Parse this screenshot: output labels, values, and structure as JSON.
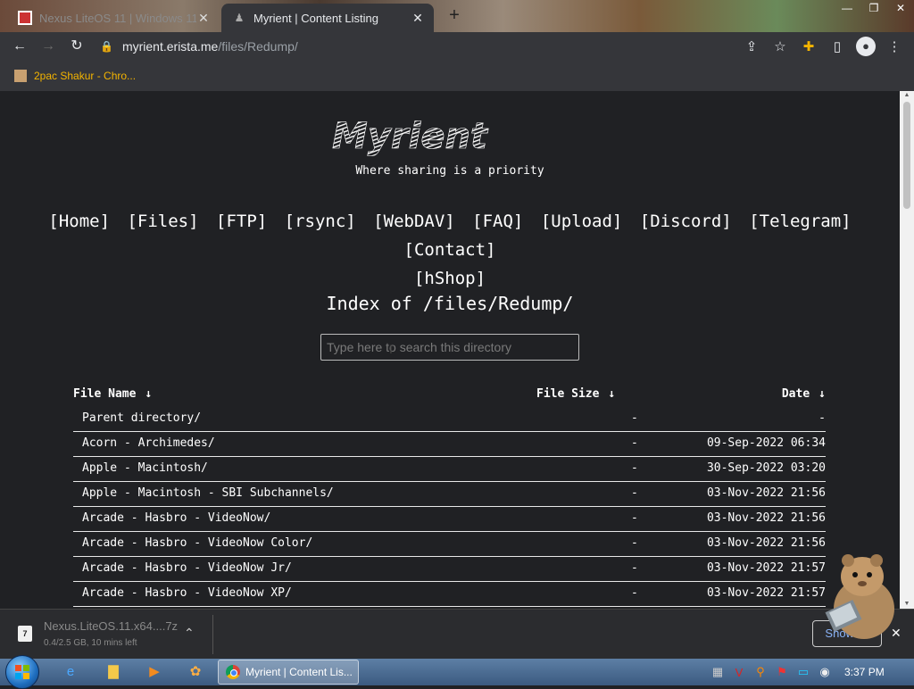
{
  "browser": {
    "tabs": [
      {
        "title": "Nexus LiteOS 11 | Windows 11 Li...",
        "active": false
      },
      {
        "title": "Myrient | Content Listing",
        "active": true
      }
    ],
    "url_host": "myrient.erista.me",
    "url_path": "/files/Redump/",
    "bookmark": "2pac Shakur - Chro..."
  },
  "page": {
    "logo_text": "Myrient",
    "tagline": "Where sharing is a priority",
    "nav": [
      "[Home]",
      "[Files]",
      "[FTP]",
      "[rsync]",
      "[WebDAV]",
      "[FAQ]",
      "[Upload]",
      "[Discord]",
      "[Telegram]",
      "[Contact]",
      "[hShop]"
    ],
    "title": "Index of /files/Redump/",
    "search_placeholder": "Type here to search this directory",
    "columns": {
      "name": "File Name",
      "size": "File Size",
      "date": "Date",
      "sort_icon": "↓"
    },
    "rows": [
      {
        "name": "Parent directory/",
        "size": "-",
        "date": "-"
      },
      {
        "name": "Acorn - Archimedes/",
        "size": "-",
        "date": "09-Sep-2022 06:34"
      },
      {
        "name": "Apple - Macintosh/",
        "size": "-",
        "date": "30-Sep-2022 03:20"
      },
      {
        "name": "Apple - Macintosh - SBI Subchannels/",
        "size": "-",
        "date": "03-Nov-2022 21:56"
      },
      {
        "name": "Arcade - Hasbro - VideoNow/",
        "size": "-",
        "date": "03-Nov-2022 21:56"
      },
      {
        "name": "Arcade - Hasbro - VideoNow Color/",
        "size": "-",
        "date": "03-Nov-2022 21:56"
      },
      {
        "name": "Arcade - Hasbro - VideoNow Jr/",
        "size": "-",
        "date": "03-Nov-2022 21:57"
      },
      {
        "name": "Arcade - Hasbro - VideoNow XP/",
        "size": "-",
        "date": "03-Nov-2022 21:57"
      }
    ]
  },
  "download": {
    "file_name": "Nexus.LiteOS.11.x64....7z",
    "status": "0.4/2.5 GB, 10 mins left",
    "show_all": "Show all"
  },
  "taskbar": {
    "active_window": "Myrient | Content Lis...",
    "clock": "3:37 PM"
  },
  "colors": {
    "page_bg": "#202124",
    "text": "#ffffff",
    "bookmark_text": "#f4b400",
    "link_accent": "#8ab4f8"
  },
  "icons": [
    "back-icon",
    "forward-icon",
    "reload-icon",
    "lock-icon",
    "share-icon",
    "star-icon",
    "extension-icon",
    "sidebar-icon",
    "profile-icon",
    "menu-icon",
    "close-icon",
    "chevron-up-icon",
    "start-button",
    "ie-icon",
    "folder-icon",
    "media-player-icon",
    "paint-icon",
    "chrome-icon"
  ]
}
